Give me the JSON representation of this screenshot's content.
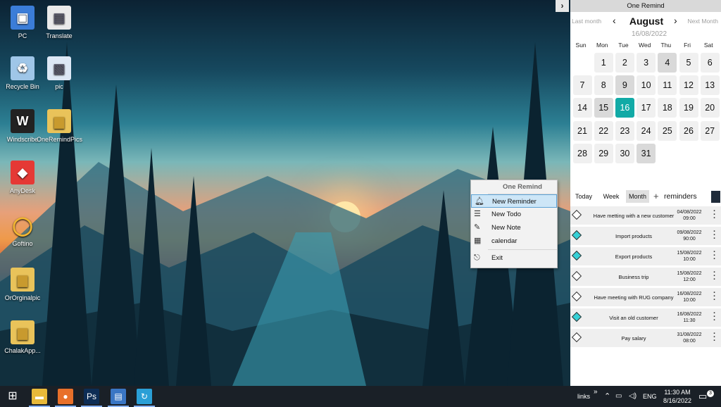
{
  "desktop": {
    "icons": [
      {
        "label": "PC",
        "icon": "computer-icon"
      },
      {
        "label": "Translate",
        "icon": "document-icon"
      },
      {
        "label": "Recycle Bin",
        "icon": "recycle-bin-icon"
      },
      {
        "label": "pic",
        "icon": "image-file-icon"
      },
      {
        "label": "Windscribe",
        "icon": "windscribe-icon"
      },
      {
        "label": "OneRemindPics",
        "icon": "folder-icon"
      },
      {
        "label": "AnyDesk",
        "icon": "anydesk-icon"
      },
      {
        "label": "Goftino",
        "icon": "goftino-icon"
      },
      {
        "label": "OrOrginalpic",
        "icon": "folder-icon"
      },
      {
        "label": "ChalakApp...",
        "icon": "folder-icon"
      }
    ]
  },
  "context_menu": {
    "title": "One Remind",
    "items": [
      {
        "label": "New Reminder",
        "icon": "bell-icon",
        "selected": true
      },
      {
        "label": "New Todo",
        "icon": "todo-list-icon"
      },
      {
        "label": "New Note",
        "icon": "note-icon"
      },
      {
        "label": "calendar",
        "icon": "calendar-icon"
      },
      {
        "label": "Exit",
        "icon": "exit-icon"
      }
    ]
  },
  "panel": {
    "title": "One Remind",
    "collapse_glyph": "›",
    "last_month": "Last month",
    "next_month": "Next Month",
    "prev_arrow": "‹",
    "next_arrow": "›",
    "month": "August",
    "date": "16/08/2022",
    "weekdays": [
      "Sun",
      "Mon",
      "Tue",
      "Wed",
      "Thu",
      "Fri",
      "Sat"
    ],
    "first_weekday_index": 1,
    "days_in_month": 31,
    "busy_days": [
      4,
      9,
      15,
      31
    ],
    "today": 16,
    "tabs": [
      "Today",
      "Week",
      "Month"
    ],
    "active_tab": "Month",
    "add_glyph": "+",
    "reminders_label": "reminders",
    "reminders": [
      {
        "title": "Have metting with a new customer",
        "date": "04/08/2022",
        "time": "09:00",
        "done": false
      },
      {
        "title": "Import products",
        "date": "09/08/2022",
        "time": "90:00",
        "done": true
      },
      {
        "title": "Export products",
        "date": "15/08/2022",
        "time": "10:00",
        "done": true
      },
      {
        "title": "Business trip",
        "date": "15/08/2022",
        "time": "12:00",
        "done": false
      },
      {
        "title": "Have meeting with RUG company",
        "date": "16/08/2022",
        "time": "10:00",
        "done": false
      },
      {
        "title": "Visit an old customer",
        "date": "16/08/2022",
        "time": "11:30",
        "done": true
      },
      {
        "title": "Pay salary",
        "date": "31/08/2022",
        "time": "08:00",
        "done": false
      }
    ]
  },
  "taskbar": {
    "apps": [
      {
        "name": "start-button",
        "glyph": "⊞",
        "color": "#1a2027"
      },
      {
        "name": "file-explorer-icon",
        "glyph": "▬",
        "color": "#e8b93a"
      },
      {
        "name": "firefox-icon",
        "glyph": "●",
        "color": "#e8702a"
      },
      {
        "name": "photoshop-icon",
        "glyph": "Ps",
        "color": "#0d2d55"
      },
      {
        "name": "text-editor-icon",
        "glyph": "▤",
        "color": "#3a76c4"
      },
      {
        "name": "oneremind-icon",
        "glyph": "↻",
        "color": "#2a9fd6"
      }
    ],
    "links_label": "links",
    "chevron": "»",
    "language": "ENG",
    "time": "11:30 AM",
    "date": "8/16/2022",
    "notification_count": "3"
  }
}
